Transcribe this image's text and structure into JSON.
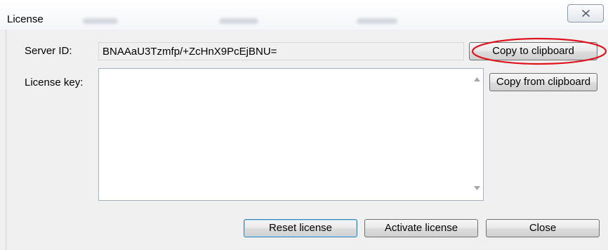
{
  "window": {
    "title": "License"
  },
  "server_id": {
    "label": "Server ID:",
    "value": "BNAAaU3Tzmfp/+ZcHnX9PcEjBNU="
  },
  "license_key": {
    "label": "License key:",
    "value": ""
  },
  "buttons": {
    "copy_to_clipboard": "Copy to clipboard",
    "copy_from_clipboard": "Copy from clipboard",
    "reset_license": "Reset license",
    "activate_license": "Activate license",
    "close": "Close"
  },
  "colors": {
    "annotation": "#e0141e"
  }
}
